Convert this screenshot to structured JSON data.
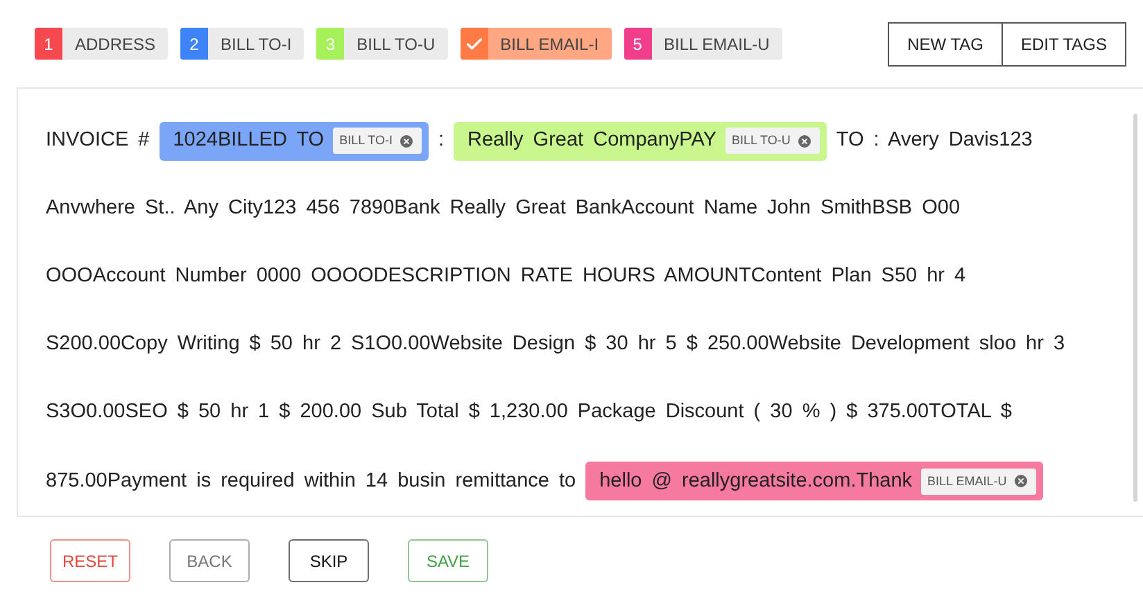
{
  "tags": [
    {
      "key": "1",
      "label": "ADDRESS",
      "color": "#f5484f",
      "selected": false
    },
    {
      "key": "2",
      "label": "BILL TO-I",
      "color": "#3f83f8",
      "selected": false
    },
    {
      "key": "3",
      "label": "BILL TO-U",
      "color": "#a6f05a",
      "selected": false
    },
    {
      "label": "BILL EMAIL-I",
      "color": "#ff7a45",
      "selected": true
    },
    {
      "key": "5",
      "label": "BILL EMAIL-U",
      "color": "#f03e8a",
      "selected": false
    }
  ],
  "tag_actions": [
    "NEW TAG",
    "EDIT TAGS"
  ],
  "lines": [
    [
      {
        "kind": "text",
        "text": "INVOICE #"
      },
      {
        "kind": "entity",
        "text": "1024BILLED TO",
        "tag": "BILL TO-I",
        "color": "#7ba6f7"
      },
      {
        "kind": "text",
        "text": ":"
      },
      {
        "kind": "entity",
        "text": "Really Great CompanyPAY",
        "tag": "BILL TO-U",
        "color": "#c9f78e"
      },
      {
        "kind": "text",
        "text": "TO : Avery Davis123"
      }
    ],
    [
      {
        "kind": "text",
        "text": "Anvwhere St.. Any City123 456 7890Bank Really Great BankAccount Name John SmithBSB O00"
      }
    ],
    [
      {
        "kind": "text",
        "text": "OOOAccount Number 0000 OOOODESCRIPTION RATE HOURS AMOUNTContent Plan S50 hr 4"
      }
    ],
    [
      {
        "kind": "text",
        "text": "S200.00Copy Writing $ 50 hr 2 S1O0.00Website Design $ 30 hr 5 $ 250.00Website Development sloo hr 3"
      }
    ],
    [
      {
        "kind": "text",
        "text": "S3O0.00SEO $ 50 hr 1 $ 200.00 Sub Total $ 1,230.00 Package Discount ( 30 % ) $ 375.00TOTAL $"
      }
    ],
    [
      {
        "kind": "text",
        "text": "875.00Payment is required within 14 busin remittance to"
      },
      {
        "kind": "entity",
        "text": "hello @ reallygreatsite.com.Thank",
        "tag": "BILL EMAIL-U",
        "color": "#f6799f"
      }
    ]
  ],
  "buttons": [
    {
      "label": "RESET",
      "color": "#e5483f"
    },
    {
      "label": "BACK",
      "color": "#777777"
    },
    {
      "label": "SKIP",
      "color": "#111111"
    },
    {
      "label": "SAVE",
      "color": "#43a047"
    }
  ]
}
